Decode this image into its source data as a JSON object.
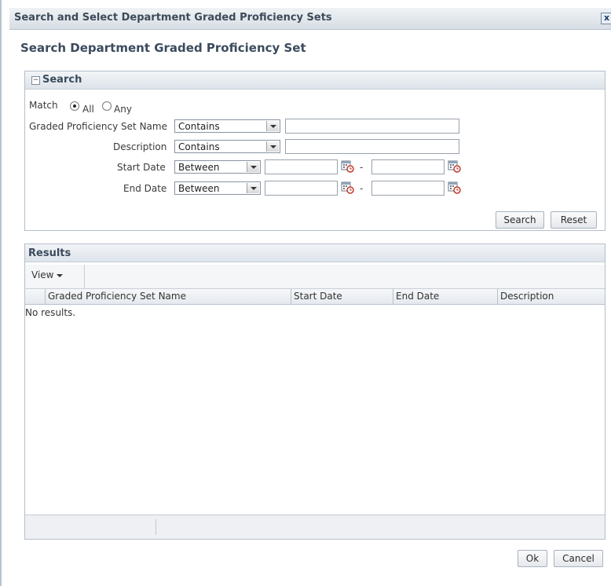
{
  "dialog": {
    "title": "Search and Select Department Graded Proficiency Sets",
    "close_glyph": "x",
    "page_title": "Search Department Graded Proficiency Set"
  },
  "search": {
    "header": "Search",
    "collapse_glyph": "−",
    "match_label": "Match",
    "match_all": "All",
    "match_any": "Any",
    "match_selected": "All",
    "fields": {
      "name_label": "Graded Proficiency Set Name",
      "name_operator": "Contains",
      "name_value": "",
      "description_label": "Description",
      "description_operator": "Contains",
      "description_value": "",
      "start_label": "Start Date",
      "start_operator": "Between",
      "start_from": "",
      "start_to": "",
      "end_label": "End Date",
      "end_operator": "Between",
      "end_from": "",
      "end_to": "",
      "range_separator": "-"
    },
    "search_button": "Search",
    "reset_button": "Reset"
  },
  "results": {
    "header": "Results",
    "view_menu": "View",
    "columns": [
      "Graded Proficiency Set Name",
      "Start Date",
      "End Date",
      "Description"
    ],
    "empty_text": "No results."
  },
  "buttons": {
    "ok": "Ok",
    "cancel": "Cancel"
  }
}
